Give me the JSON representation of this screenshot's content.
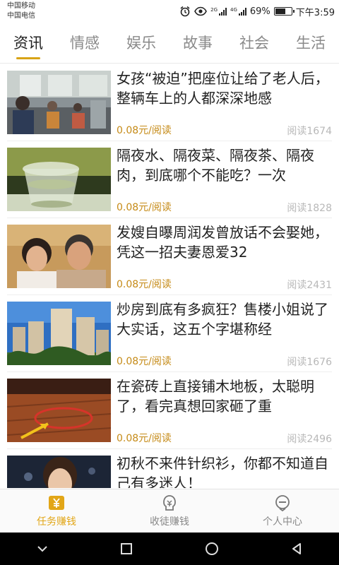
{
  "status_bar": {
    "carrier1": "中国移动",
    "carrier2": "中国电信",
    "net1": "2G",
    "net2": "4G",
    "battery": "69%",
    "battery_level": 0.69,
    "time": "下午3:59"
  },
  "tabs": [
    {
      "label": "资讯",
      "active": true
    },
    {
      "label": "情感"
    },
    {
      "label": "娱乐"
    },
    {
      "label": "故事"
    },
    {
      "label": "社会"
    },
    {
      "label": "生活"
    }
  ],
  "articles": [
    {
      "title": "女孩“被迫”把座位让给了老人后，整辆车上的人都深深地感",
      "reward": "0.08元/阅读",
      "reads": "阅读1674"
    },
    {
      "title": "隔夜水、隔夜菜、隔夜茶、隔夜肉，到底哪个不能吃？一次",
      "reward": "0.08元/阅读",
      "reads": "阅读1828"
    },
    {
      "title": "发嫂自曝周润发曾放话不会娶她，凭这一招夫妻恩爱32",
      "reward": "0.08元/阅读",
      "reads": "阅读2431"
    },
    {
      "title": "炒房到底有多疯狂？售楼小姐说了大实话，这五个字堪称经",
      "reward": "0.08元/阅读",
      "reads": "阅读1676"
    },
    {
      "title": "在瓷砖上直接铺木地板，太聪明了，看完真想回家砸了重",
      "reward": "0.08元/阅读",
      "reads": "阅读2496"
    },
    {
      "title": "初秋不来件针织衫，你都不知道自己有多迷人！",
      "reward": "",
      "reads": ""
    }
  ],
  "bottom_nav": [
    {
      "label": "任务赚钱",
      "icon": "yuan-icon",
      "active": true
    },
    {
      "label": "收徒赚钱",
      "icon": "apprentice-icon"
    },
    {
      "label": "个人中心",
      "icon": "profile-icon"
    }
  ],
  "colors": {
    "accent": "#e2a617",
    "reward": "#c58a16"
  }
}
